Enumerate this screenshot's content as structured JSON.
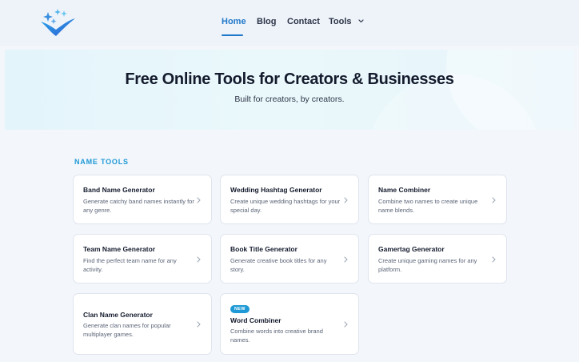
{
  "nav": {
    "home": "Home",
    "blog": "Blog",
    "contact": "Contact",
    "tools": "Tools"
  },
  "hero": {
    "title": "Free Online Tools for Creators & Businesses",
    "subtitle": "Built for creators, by creators."
  },
  "section": {
    "title": "NAME TOOLS"
  },
  "cards": [
    {
      "title": "Band Name Generator",
      "desc": "Generate catchy band names instantly for any genre."
    },
    {
      "title": "Wedding Hashtag Generator",
      "desc": "Create unique wedding hashtags for your special day."
    },
    {
      "title": "Name Combiner",
      "desc": "Combine two names to create unique name blends."
    },
    {
      "title": "Team Name Generator",
      "desc": "Find the perfect team name for any activity."
    },
    {
      "title": "Book Title Generator",
      "desc": "Generate creative book titles for any story."
    },
    {
      "title": "Gamertag Generator",
      "desc": "Create unique gaming names for any platform."
    },
    {
      "title": "Clan Name Generator",
      "desc": "Generate clan names for popular multiplayer games."
    },
    {
      "title": "Word Combiner",
      "desc": "Combine words into creative brand names.",
      "badge": "NEW"
    }
  ],
  "colors": {
    "accent": "#1f78c8",
    "section_accent": "#1f9ad6",
    "badge": "#1f9ad6"
  },
  "icons": {
    "logo": "sparkle-check-logo",
    "tools_dropdown": "chevron-down-icon",
    "card_arrow": "chevron-right-icon"
  }
}
